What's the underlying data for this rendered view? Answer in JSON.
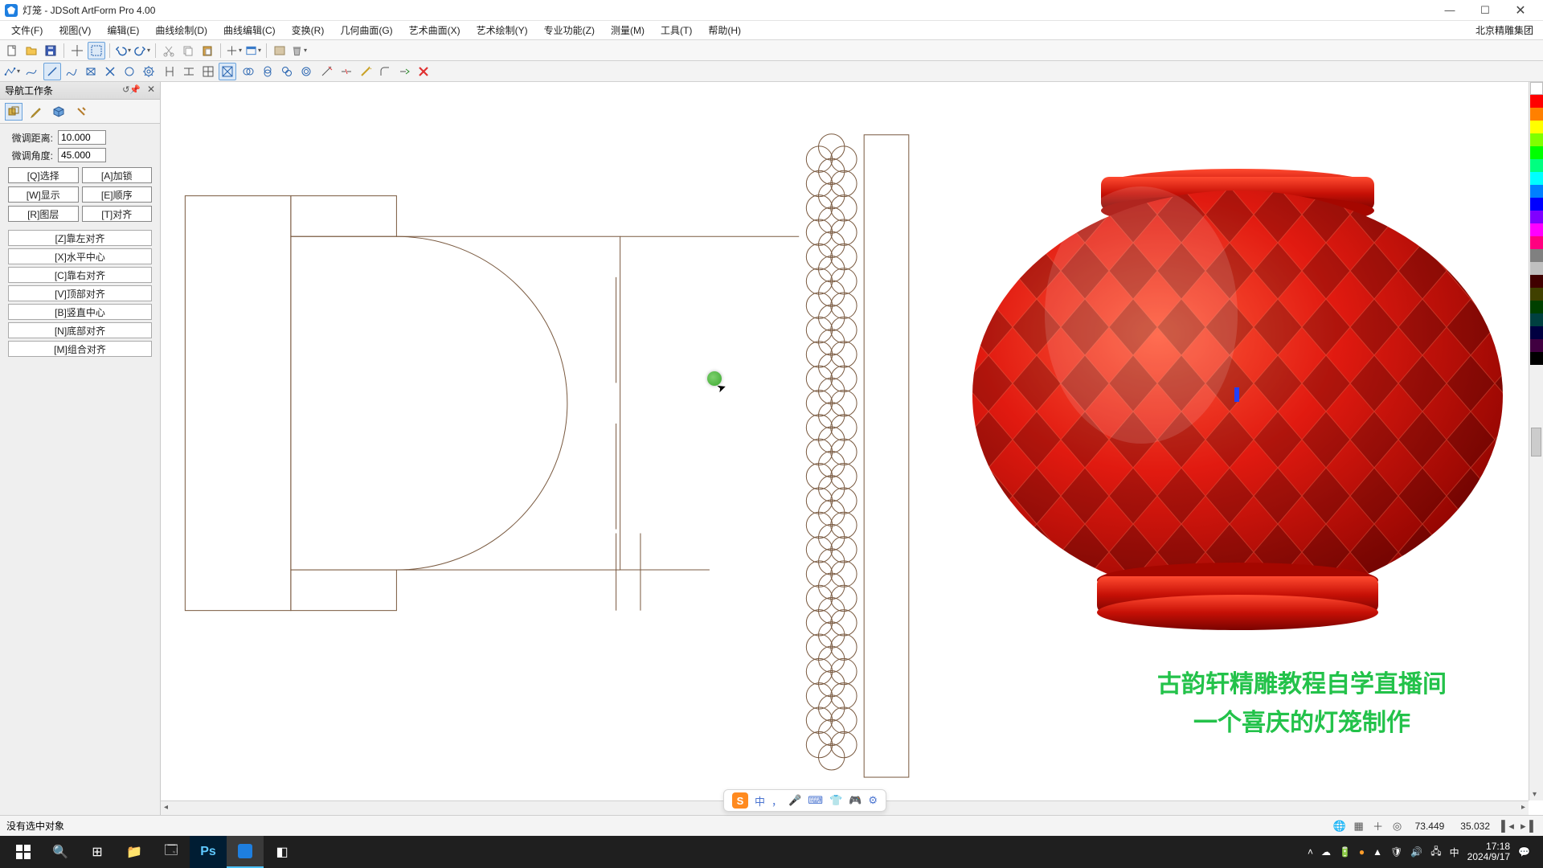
{
  "window": {
    "title": "灯笼 - JDSoft ArtForm Pro 4.00",
    "brand": "北京精雕集团"
  },
  "menus": [
    "文件(F)",
    "视图(V)",
    "编辑(E)",
    "曲线绘制(D)",
    "曲线编辑(C)",
    "变换(R)",
    "几何曲面(G)",
    "艺术曲面(X)",
    "艺术绘制(Y)",
    "专业功能(Z)",
    "测量(M)",
    "工具(T)",
    "帮助(H)"
  ],
  "nav": {
    "title": "导航工作条",
    "fields": {
      "dist_label": "微调距离:",
      "dist_value": "10.000",
      "angle_label": "微调角度:",
      "angle_value": "45.000"
    },
    "buttons": [
      "[Q]选择",
      "[A]加锁",
      "[W]显示",
      "[E]顺序",
      "[R]图层",
      "[T]对齐"
    ],
    "align": [
      "[Z]靠左对齐",
      "[X]水平中心",
      "[C]靠右对齐",
      "[V]顶部对齐",
      "[B]竖直中心",
      "[N]底部对齐",
      "[M]组合对齐"
    ]
  },
  "overlay": {
    "line1": "古韵轩精雕教程自学直播间",
    "line2": "一个喜庆的灯笼制作"
  },
  "status": {
    "left": "没有选中对象",
    "coord_x": "73.449",
    "coord_y": "35.032"
  },
  "ime": {
    "mode": "中",
    "items": [
      "中",
      "，",
      "🎤",
      "⌨",
      "👕",
      "🎮",
      "⚙"
    ]
  },
  "colors": [
    "#ffffff",
    "#ff0000",
    "#ff8000",
    "#ffff00",
    "#80ff00",
    "#00ff00",
    "#00ff80",
    "#00ffff",
    "#0080ff",
    "#0000ff",
    "#8000ff",
    "#ff00ff",
    "#ff0080",
    "#808080",
    "#c0c0c0",
    "#400000",
    "#404000",
    "#004000",
    "#004040",
    "#000040",
    "#400040",
    "#000000"
  ],
  "taskbar": {
    "time": "17:18",
    "date": "2024/9/17",
    "lang": "中"
  }
}
